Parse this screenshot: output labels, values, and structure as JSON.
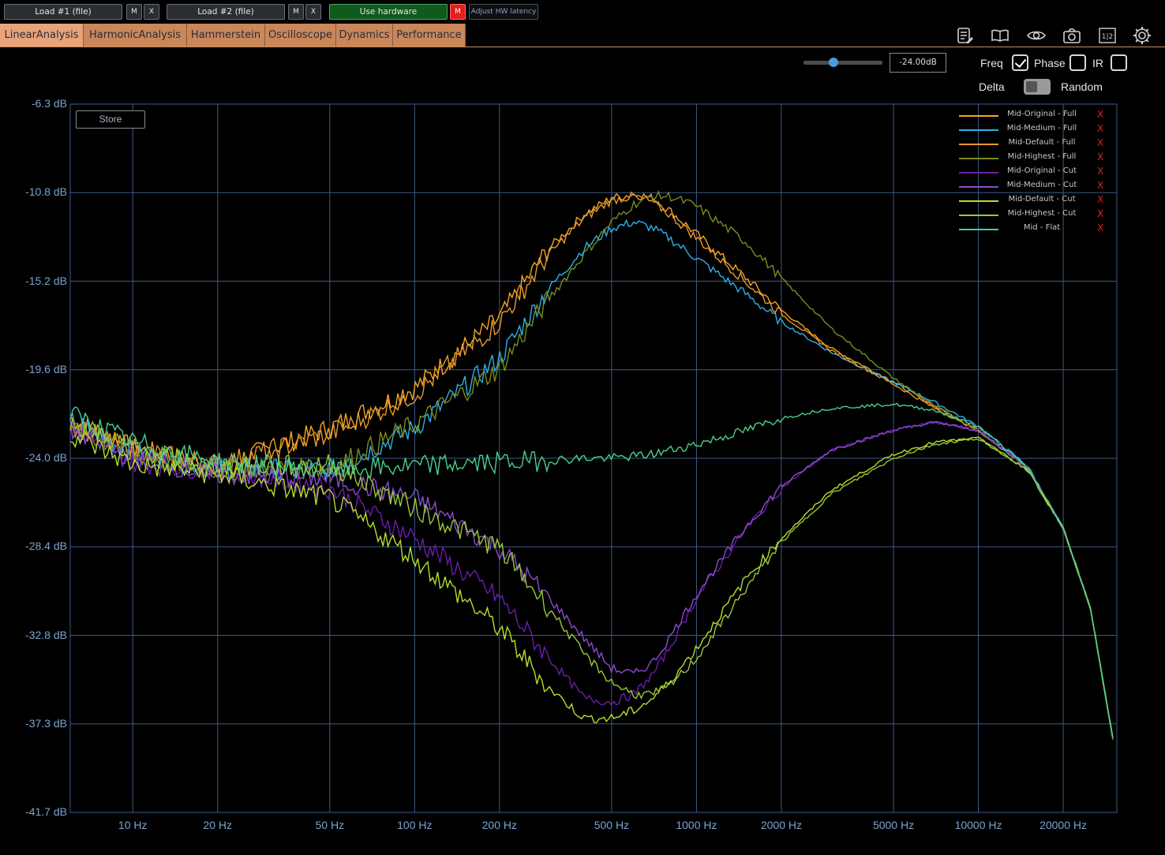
{
  "toolbar": {
    "load1": "Load #1 (file)",
    "load2": "Load #2 (file)",
    "m": "M",
    "x": "X",
    "use_hardware": "Use hardware",
    "hw_m": "M",
    "adjust_latency": "Adjust HW latency"
  },
  "tabs": [
    "LinearAnalysis",
    "HarmonicAnalysis",
    "Hammerstein",
    "Oscilloscope",
    "Dynamics",
    "Performance"
  ],
  "icons": [
    "notes-icon",
    "book-icon",
    "eye-icon",
    "camera-icon",
    "split-view-icon",
    "gear-icon"
  ],
  "split_view_label": "1|2",
  "controls": {
    "gain_value": "-24.00dB",
    "gain_slider_fraction": 0.38,
    "freq_label": "Freq",
    "freq_checked": true,
    "phase_label": "Phase",
    "phase_checked": false,
    "ir_label": "IR",
    "ir_checked": false,
    "delta_label": "Delta",
    "random_label": "Random"
  },
  "plot": {
    "store_label": "Store",
    "colors": {
      "grid": "#3e5a88",
      "axis_text": "#7aa3d0",
      "background": "#000000"
    }
  },
  "chart_data": {
    "type": "line",
    "xscale": "log",
    "xlim": [
      6,
      31000
    ],
    "ylim": [
      -41.7,
      -6.3
    ],
    "y_ticks": [
      "-6.3 dB",
      "-10.8 dB",
      "-15.2 dB",
      "-19.6 dB",
      "-24.0 dB",
      "-28.4 dB",
      "-32.8 dB",
      "-37.3 dB",
      "-41.7 dB"
    ],
    "x_ticks": [
      "10 Hz",
      "20 Hz",
      "50 Hz",
      "100 Hz",
      "200 Hz",
      "500 Hz",
      "1000 Hz",
      "2000 Hz",
      "5000 Hz",
      "10000 Hz",
      "20000 Hz"
    ],
    "x_tick_values": [
      10,
      20,
      50,
      100,
      200,
      500,
      1000,
      2000,
      5000,
      10000,
      20000
    ],
    "grid": true,
    "legend": "top-right",
    "series": [
      {
        "name": "Mid-Original - Full",
        "color": "#f5a623",
        "x": [
          6,
          10,
          20,
          50,
          100,
          200,
          300,
          400,
          500,
          600,
          700,
          800,
          1000,
          1500,
          2000,
          3000,
          5000,
          7000,
          10000,
          15000,
          20000,
          25000,
          30000
        ],
        "y": [
          -22.0,
          -23.5,
          -24.4,
          -22.5,
          -20.5,
          -17.0,
          -13.5,
          -11.8,
          -11.0,
          -10.8,
          -11.0,
          -11.6,
          -12.8,
          -15.0,
          -16.6,
          -18.5,
          -20.2,
          -21.4,
          -22.6,
          -24.5,
          -27.5,
          -31.5,
          -38.0
        ]
      },
      {
        "name": "Mid-Medium - Full",
        "color": "#2fb0e8",
        "x": [
          6,
          10,
          20,
          50,
          100,
          200,
          300,
          400,
          500,
          600,
          700,
          800,
          1000,
          1500,
          2000,
          3000,
          5000,
          7000,
          10000,
          15000,
          20000,
          25000,
          30000
        ],
        "y": [
          -22.2,
          -23.7,
          -24.5,
          -24.6,
          -22.5,
          -19.0,
          -15.5,
          -13.5,
          -12.5,
          -12.2,
          -12.5,
          -13.0,
          -14.0,
          -15.8,
          -17.2,
          -18.7,
          -20.2,
          -21.2,
          -22.4,
          -24.4,
          -27.5,
          -31.5,
          -38.0
        ]
      },
      {
        "name": "Mid-Default - Full",
        "color": "#e89a2c",
        "x": [
          6,
          10,
          20,
          50,
          100,
          200,
          300,
          400,
          500,
          600,
          700,
          800,
          1000,
          1500,
          2000,
          3000,
          5000,
          7000,
          10000,
          15000,
          20000,
          25000,
          30000
        ],
        "y": [
          -22.3,
          -23.6,
          -24.3,
          -22.8,
          -20.8,
          -17.2,
          -13.8,
          -12.0,
          -11.1,
          -10.9,
          -11.2,
          -11.8,
          -13.0,
          -15.2,
          -16.8,
          -18.6,
          -20.3,
          -21.5,
          -22.6,
          -24.5,
          -27.5,
          -31.5,
          -38.0
        ]
      },
      {
        "name": "Mid-Highest - Full",
        "color": "#7a8c1c",
        "x": [
          6,
          10,
          20,
          50,
          100,
          200,
          300,
          400,
          500,
          600,
          700,
          800,
          1000,
          1500,
          2000,
          3000,
          5000,
          7000,
          10000,
          15000,
          20000,
          25000,
          30000
        ],
        "y": [
          -22.4,
          -23.8,
          -24.6,
          -24.5,
          -22.3,
          -19.5,
          -16.0,
          -13.8,
          -12.2,
          -11.3,
          -10.9,
          -10.9,
          -11.4,
          -13.2,
          -15.0,
          -17.5,
          -20.0,
          -21.4,
          -22.6,
          -24.5,
          -27.5,
          -31.5,
          -38.0
        ]
      },
      {
        "name": "Mid-Original - Cut",
        "color": "#6a1ea8",
        "x": [
          6,
          10,
          20,
          50,
          100,
          200,
          300,
          400,
          500,
          600,
          700,
          800,
          1000,
          1500,
          2000,
          3000,
          5000,
          7000,
          10000,
          15000,
          20000,
          25000,
          30000
        ],
        "y": [
          -22.5,
          -24.2,
          -24.6,
          -25.5,
          -28.0,
          -31.0,
          -34.0,
          -36.0,
          -36.2,
          -35.8,
          -34.8,
          -33.5,
          -31.0,
          -27.5,
          -25.5,
          -23.6,
          -22.6,
          -22.2,
          -22.6,
          -24.5,
          -27.5,
          -31.5,
          -38.0
        ]
      },
      {
        "name": "Mid-Medium - Cut",
        "color": "#8a4ccc",
        "x": [
          6,
          10,
          20,
          50,
          100,
          200,
          300,
          400,
          500,
          600,
          700,
          800,
          1000,
          1500,
          2000,
          3000,
          5000,
          7000,
          10000,
          15000,
          20000,
          25000,
          30000
        ],
        "y": [
          -22.6,
          -24.0,
          -24.8,
          -25.0,
          -26.0,
          -28.5,
          -31.0,
          -33.0,
          -34.5,
          -34.8,
          -34.2,
          -33.0,
          -30.8,
          -27.4,
          -25.4,
          -23.6,
          -22.6,
          -22.2,
          -22.6,
          -24.5,
          -27.5,
          -31.5,
          -38.0
        ]
      },
      {
        "name": "Mid-Default - Cut",
        "color": "#b6e02a",
        "x": [
          6,
          10,
          20,
          50,
          100,
          200,
          300,
          400,
          500,
          600,
          700,
          800,
          1000,
          1500,
          2000,
          3000,
          5000,
          7000,
          10000,
          15000,
          20000,
          25000,
          30000
        ],
        "y": [
          -22.8,
          -24.3,
          -24.8,
          -26.0,
          -29.0,
          -32.5,
          -35.5,
          -37.0,
          -37.0,
          -36.6,
          -36.0,
          -35.2,
          -33.5,
          -30.0,
          -28.0,
          -25.6,
          -23.8,
          -23.2,
          -23.0,
          -24.6,
          -27.5,
          -31.5,
          -38.0
        ]
      },
      {
        "name": "Mid-Highest - Cut",
        "color": "#98c838",
        "x": [
          6,
          10,
          20,
          50,
          100,
          200,
          300,
          400,
          500,
          600,
          700,
          800,
          1000,
          1500,
          2000,
          3000,
          5000,
          7000,
          10000,
          15000,
          20000,
          25000,
          30000
        ],
        "y": [
          -22.2,
          -23.5,
          -24.5,
          -24.3,
          -26.5,
          -28.5,
          -31.5,
          -33.8,
          -35.2,
          -35.8,
          -35.8,
          -35.4,
          -34.0,
          -30.5,
          -28.2,
          -25.8,
          -24.0,
          -23.3,
          -23.0,
          -24.6,
          -27.5,
          -31.5,
          -38.0
        ]
      },
      {
        "name": "Mid - Flat",
        "color": "#4ad08a",
        "x": [
          6,
          10,
          20,
          50,
          100,
          200,
          300,
          400,
          500,
          600,
          700,
          800,
          1000,
          1500,
          2000,
          3000,
          5000,
          7000,
          10000,
          15000,
          20000,
          25000,
          30000
        ],
        "y": [
          -21.8,
          -23.2,
          -24.2,
          -24.6,
          -24.4,
          -24.2,
          -24.1,
          -24.0,
          -24.0,
          -23.9,
          -23.8,
          -23.6,
          -23.3,
          -22.6,
          -22.0,
          -21.5,
          -21.3,
          -21.6,
          -22.4,
          -24.5,
          -27.5,
          -31.5,
          -38.0
        ]
      }
    ]
  }
}
